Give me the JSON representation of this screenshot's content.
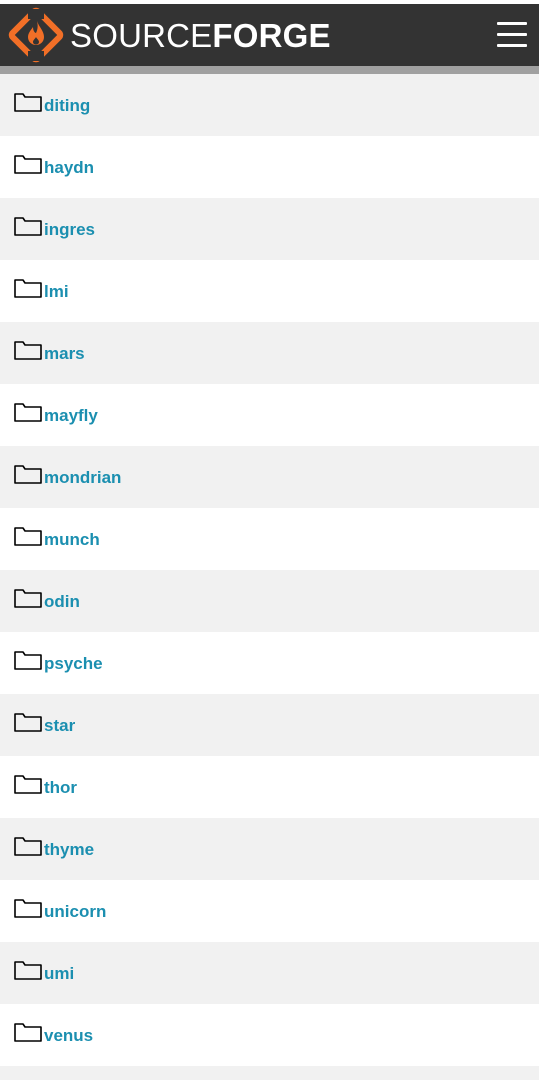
{
  "brand": {
    "name_light": "SOURCE",
    "name_bold": "FORGE",
    "logo_color": "#f26f27"
  },
  "header": {
    "menu_icon": "hamburger-menu-icon"
  },
  "colors": {
    "header_bg": "#333333",
    "link": "#1b8fb0",
    "row_alt": "#f1f1f1"
  },
  "folders": [
    {
      "label": "diting"
    },
    {
      "label": "haydn"
    },
    {
      "label": "ingres"
    },
    {
      "label": "lmi"
    },
    {
      "label": "mars"
    },
    {
      "label": "mayfly"
    },
    {
      "label": "mondrian"
    },
    {
      "label": "munch"
    },
    {
      "label": "odin"
    },
    {
      "label": "psyche"
    },
    {
      "label": "star"
    },
    {
      "label": "thor"
    },
    {
      "label": "thyme"
    },
    {
      "label": "unicorn"
    },
    {
      "label": "umi"
    },
    {
      "label": "venus"
    }
  ]
}
